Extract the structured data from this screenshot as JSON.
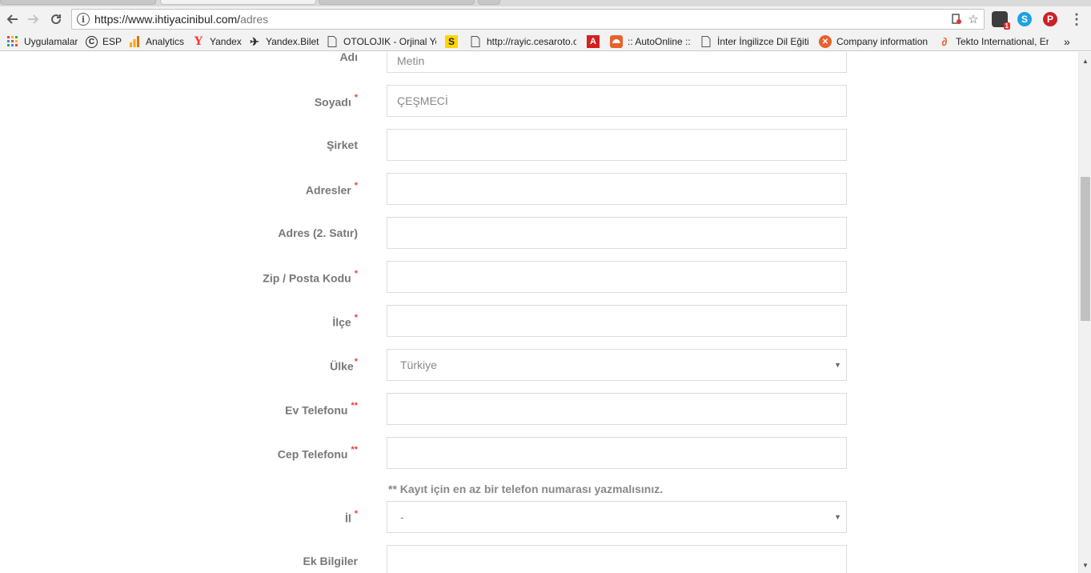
{
  "browser": {
    "url_host": "https://www.ihtiyacinibul.com/",
    "url_path": "adres",
    "back_icon": "back-arrow-icon",
    "forward_icon": "forward-arrow-icon",
    "reload_icon": "reload-icon",
    "info_glyph": "i",
    "extensions": [
      {
        "name": "ghostery-icon",
        "badge": "1",
        "color": "#3d3d3d"
      },
      {
        "name": "skype-icon",
        "glyph": "S",
        "color": "#1ea1e2"
      },
      {
        "name": "pinterest-icon",
        "glyph": "P",
        "color": "#cb2027"
      }
    ],
    "menu_glyph": "⋮"
  },
  "bookmarks": {
    "items": [
      {
        "label": "Uygulamalar",
        "icon": "apps-grid-icon"
      },
      {
        "label": "ESP",
        "icon": "copyright-icon"
      },
      {
        "label": "Analytics",
        "icon": "analytics-icon"
      },
      {
        "label": "Yandex",
        "icon": "yandex-icon"
      },
      {
        "label": "Yandex.Bilet",
        "icon": "plane-icon"
      },
      {
        "label": "OTOLOJIK - Orjinal Ye",
        "icon": "page-icon"
      },
      {
        "label": "",
        "icon": "s-icon"
      },
      {
        "label": "http://rayic.cesaroto.c",
        "icon": "page-icon"
      },
      {
        "label": "",
        "icon": "acrobat-icon"
      },
      {
        "label": ":: AutoOnline ::",
        "icon": "autoonline-icon"
      },
      {
        "label": "İnter İngilizce Dil Eğiti",
        "icon": "page-icon"
      },
      {
        "label": "Company information",
        "icon": "company-icon"
      },
      {
        "label": "Tekto International, Er",
        "icon": "tekto-icon"
      }
    ],
    "overflow": "»"
  },
  "form": {
    "fields": [
      {
        "label": "Adı",
        "required": "",
        "value": "Metin",
        "type": "text"
      },
      {
        "label": "Soyadı",
        "required": "*",
        "value": "ÇEŞMECİ",
        "type": "text"
      },
      {
        "label": "Şirket",
        "required": "",
        "value": "",
        "type": "text"
      },
      {
        "label": "Adresler",
        "required": "*",
        "value": "",
        "type": "text"
      },
      {
        "label": "Adres (2. Satır)",
        "required": "",
        "value": "",
        "type": "text"
      },
      {
        "label": "Zip / Posta Kodu",
        "required": "*",
        "value": "",
        "type": "text"
      },
      {
        "label": "İlçe",
        "required": "*",
        "value": "",
        "type": "text"
      },
      {
        "label": "Ülke",
        "required": "*",
        "value": "Türkiye",
        "type": "select"
      },
      {
        "label": "Ev Telefonu",
        "required": "**",
        "value": "",
        "type": "text"
      },
      {
        "label": "Cep Telefonu",
        "required": "**",
        "value": "",
        "type": "text"
      },
      {
        "label": "İl",
        "required": "*",
        "value": "-",
        "type": "select"
      },
      {
        "label": "Ek Bilgiler",
        "required": "",
        "value": "",
        "type": "text"
      }
    ],
    "phone_note": "** Kayıt için en az bir telefon numarası yazmalısınız.",
    "select_arrow": "▼"
  },
  "colors": {
    "required_star": "#e2433b",
    "label": "#777777",
    "field_border": "#dcdcdc"
  }
}
